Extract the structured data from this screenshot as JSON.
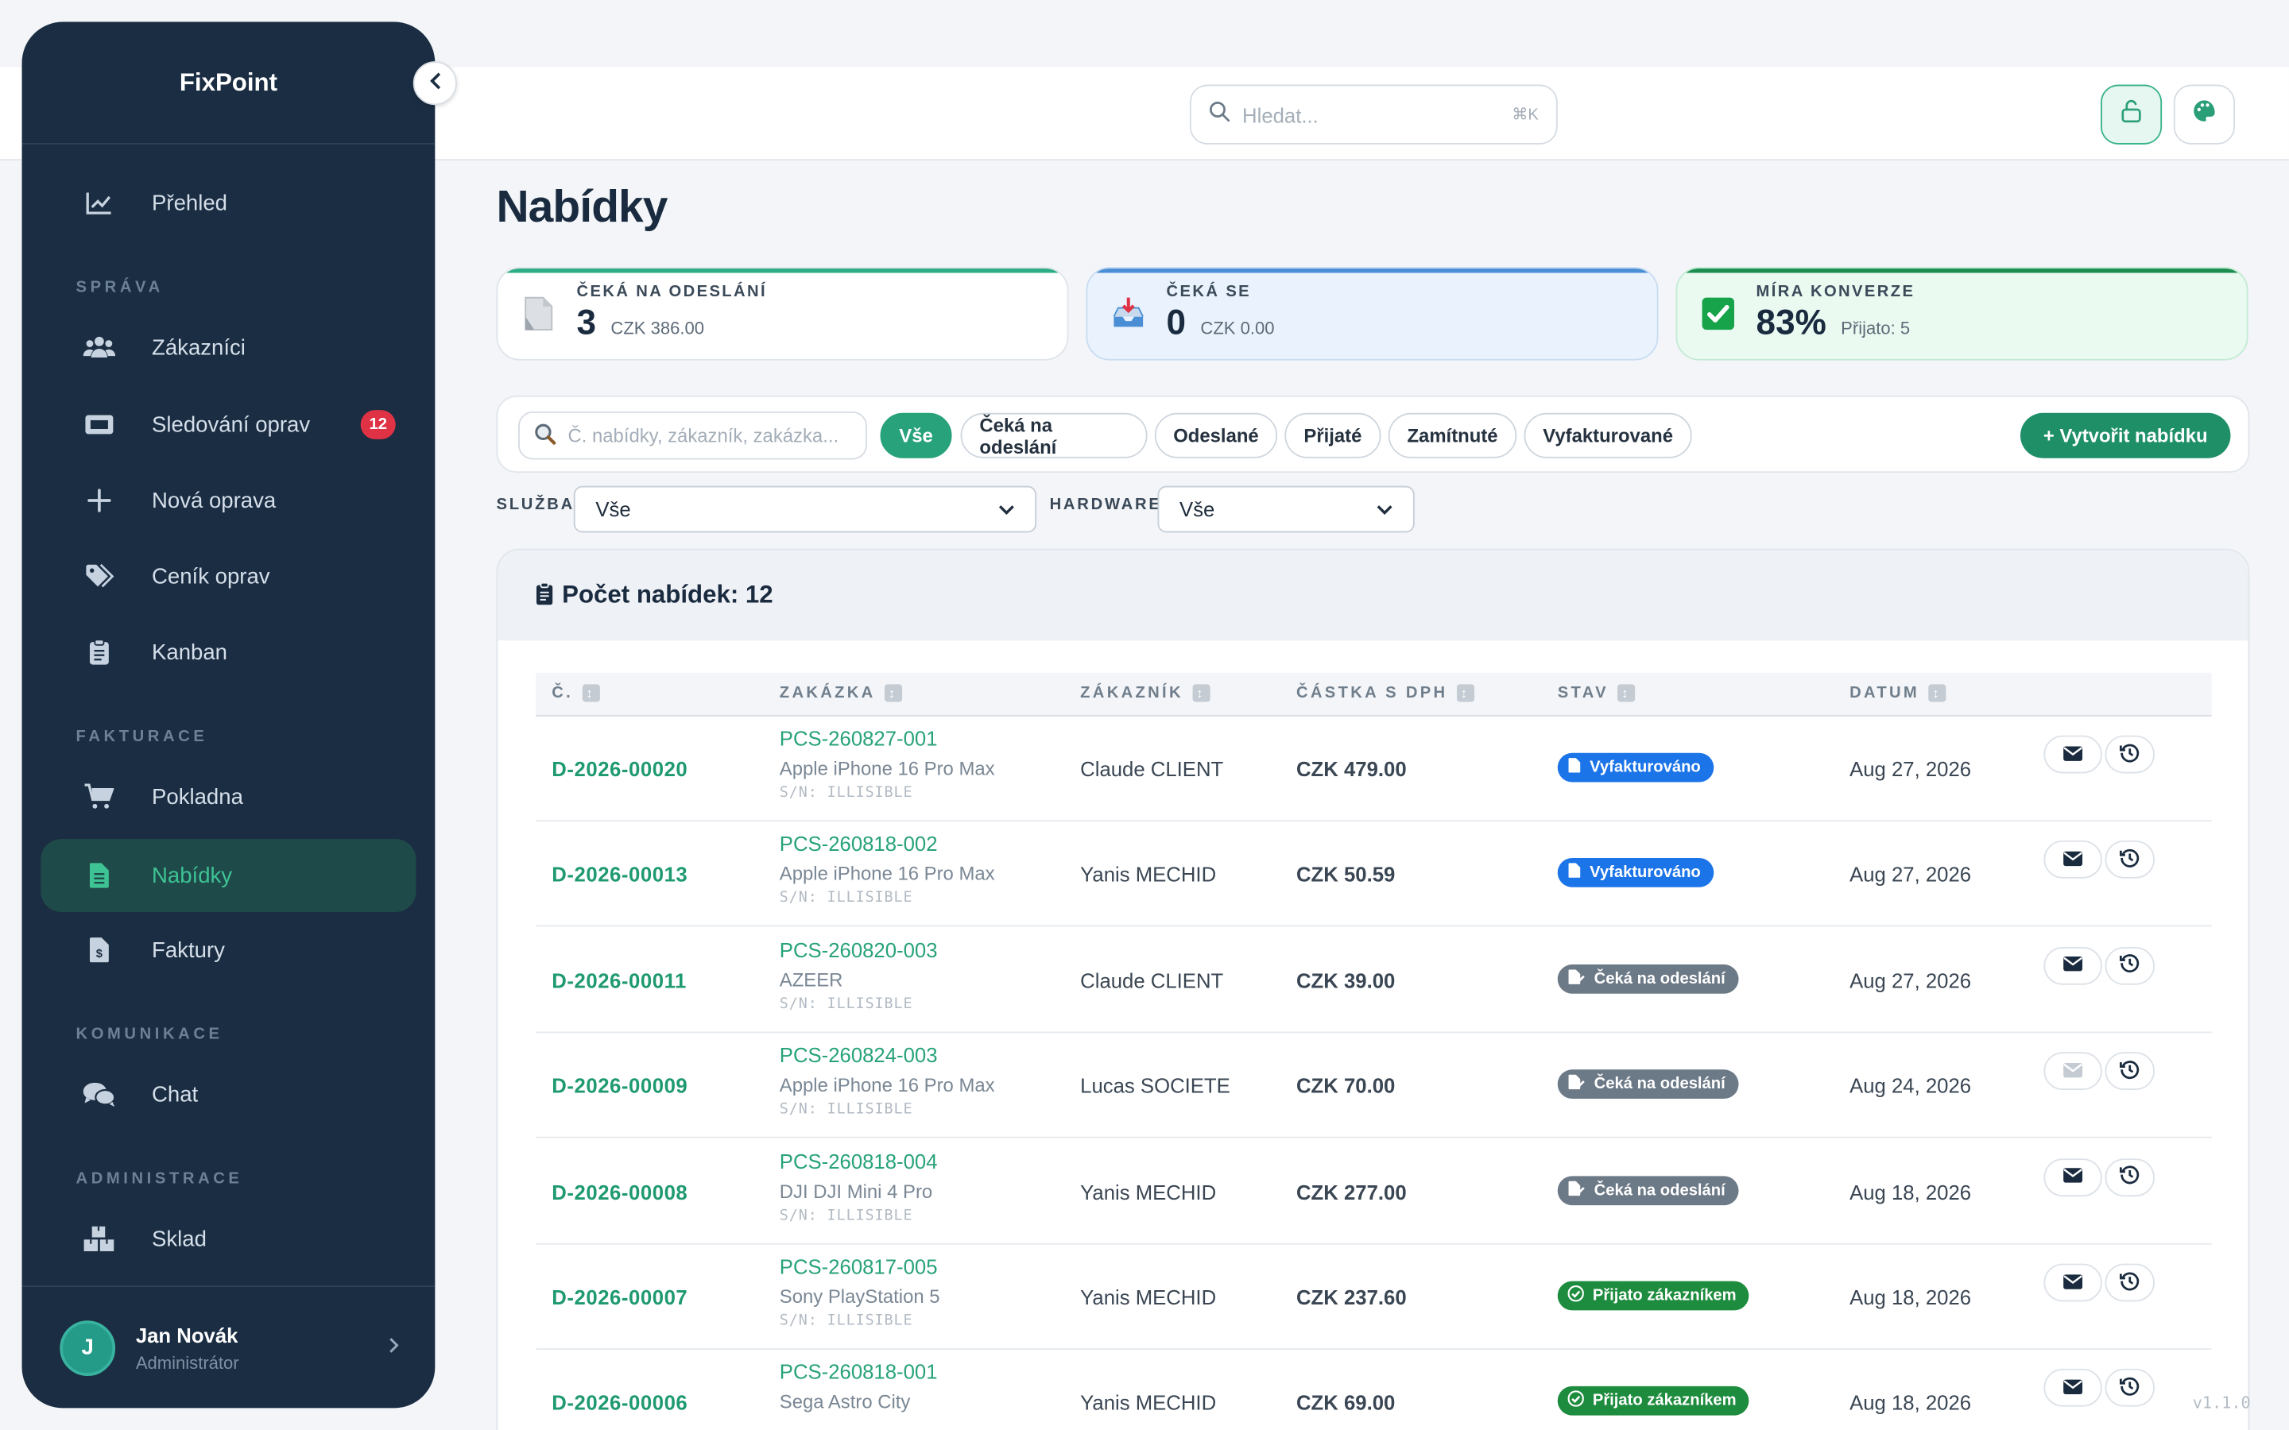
{
  "app": {
    "name": "FixPoint",
    "version": "v1.1.0"
  },
  "sidebar": {
    "top_item": {
      "label": "Přehled",
      "icon": "chart-line-icon"
    },
    "sections": [
      {
        "label": "SPRÁVA"
      },
      {
        "label": "FAKTURACE"
      },
      {
        "label": "KOMUNIKACE"
      },
      {
        "label": "ADMINISTRACE"
      }
    ],
    "items": [
      {
        "label": "Zákazníci",
        "icon": "users-icon"
      },
      {
        "label": "Sledování oprav",
        "icon": "ticket-icon",
        "badge": "12"
      },
      {
        "label": "Nová oprava",
        "icon": "plus-icon"
      },
      {
        "label": "Ceník oprav",
        "icon": "tags-icon"
      },
      {
        "label": "Kanban",
        "icon": "clipboard-icon"
      },
      {
        "label": "Pokladna",
        "icon": "cart-icon"
      },
      {
        "label": "Nabídky",
        "icon": "document-icon",
        "active": true
      },
      {
        "label": "Faktury",
        "icon": "invoice-icon"
      },
      {
        "label": "Chat",
        "icon": "comments-icon"
      },
      {
        "label": "Sklad",
        "icon": "boxes-icon"
      }
    ],
    "user": {
      "initial": "J",
      "name": "Jan Novák",
      "role": "Administrátor"
    }
  },
  "header": {
    "search_placeholder": "Hledat...",
    "search_shortcut": "⌘K"
  },
  "page": {
    "title": "Nabídky",
    "stats": [
      {
        "label": "ČEKÁ NA ODESLÁNÍ",
        "value": "3",
        "sub": "CZK 386.00"
      },
      {
        "label": "ČEKÁ SE",
        "value": "0",
        "sub": "CZK 0.00"
      },
      {
        "label": "MÍRA KONVERZE",
        "value": "83%",
        "sub": "Přijato: 5"
      }
    ],
    "filter_search_placeholder": "Č. nabídky, zákazník, zakázka...",
    "chips": [
      "Vše",
      "Čeká na odeslání",
      "Odeslané",
      "Přijaté",
      "Zamítnuté",
      "Vyfakturované"
    ],
    "create_label": "+ Vytvořit nabídku",
    "service_label": "SLUŽBA",
    "service_value": "Vše",
    "hardware_label": "HARDWARE",
    "hardware_value": "Vše"
  },
  "table": {
    "count_label": "Počet nabídek: 12",
    "columns": [
      "Č.",
      "ZAKÁZKA",
      "ZÁKAZNÍK",
      "ČÁSTKA S DPH",
      "STAV",
      "DATUM"
    ],
    "rows": [
      {
        "num": "D-2026-00020",
        "job": "PCS-260827-001",
        "device": "Apple iPhone 16 Pro Max",
        "sn": "S/N: ILLISIBLE",
        "customer": "Claude CLIENT",
        "amount": "CZK 479.00",
        "status": "Vyfakturováno",
        "status_type": "invoiced",
        "date": "Aug 27, 2026",
        "mail_enabled": true
      },
      {
        "num": "D-2026-00013",
        "job": "PCS-260818-002",
        "device": "Apple iPhone 16 Pro Max",
        "sn": "S/N: ILLISIBLE",
        "customer": "Yanis MECHID",
        "amount": "CZK 50.59",
        "status": "Vyfakturováno",
        "status_type": "invoiced",
        "date": "Aug 27, 2026",
        "mail_enabled": true
      },
      {
        "num": "D-2026-00011",
        "job": "PCS-260820-003",
        "device": "AZEER",
        "sn": "S/N: ILLISIBLE",
        "customer": "Claude CLIENT",
        "amount": "CZK 39.00",
        "status": "Čeká na odeslání",
        "status_type": "pending",
        "date": "Aug 27, 2026",
        "mail_enabled": true
      },
      {
        "num": "D-2026-00009",
        "job": "PCS-260824-003",
        "device": "Apple iPhone 16 Pro Max",
        "sn": "S/N: ILLISIBLE",
        "customer": "Lucas SOCIETE",
        "amount": "CZK 70.00",
        "status": "Čeká na odeslání",
        "status_type": "pending",
        "date": "Aug 24, 2026",
        "mail_enabled": false
      },
      {
        "num": "D-2026-00008",
        "job": "PCS-260818-004",
        "device": "DJI DJI Mini 4 Pro",
        "sn": "S/N: ILLISIBLE",
        "customer": "Yanis MECHID",
        "amount": "CZK 277.00",
        "status": "Čeká na odeslání",
        "status_type": "pending",
        "date": "Aug 18, 2026",
        "mail_enabled": true
      },
      {
        "num": "D-2026-00007",
        "job": "PCS-260817-005",
        "device": "Sony PlayStation 5",
        "sn": "S/N: ILLISIBLE",
        "customer": "Yanis MECHID",
        "amount": "CZK 237.60",
        "status": "Přijato zákazníkem",
        "status_type": "accepted",
        "date": "Aug 18, 2026",
        "mail_enabled": true
      },
      {
        "num": "D-2026-00006",
        "job": "PCS-260818-001",
        "device": "Sega Astro City",
        "sn": "",
        "customer": "Yanis MECHID",
        "amount": "CZK 69.00",
        "status": "Přijato zákazníkem",
        "status_type": "accepted",
        "date": "Aug 18, 2026",
        "mail_enabled": true
      }
    ]
  },
  "colors": {
    "sidebar": "#1b2d42",
    "accent": "#27a27a",
    "invoiced": "#1b74e8",
    "pending": "#6c7986",
    "accepted": "#1e8c3e",
    "badge_red": "#e03245"
  }
}
